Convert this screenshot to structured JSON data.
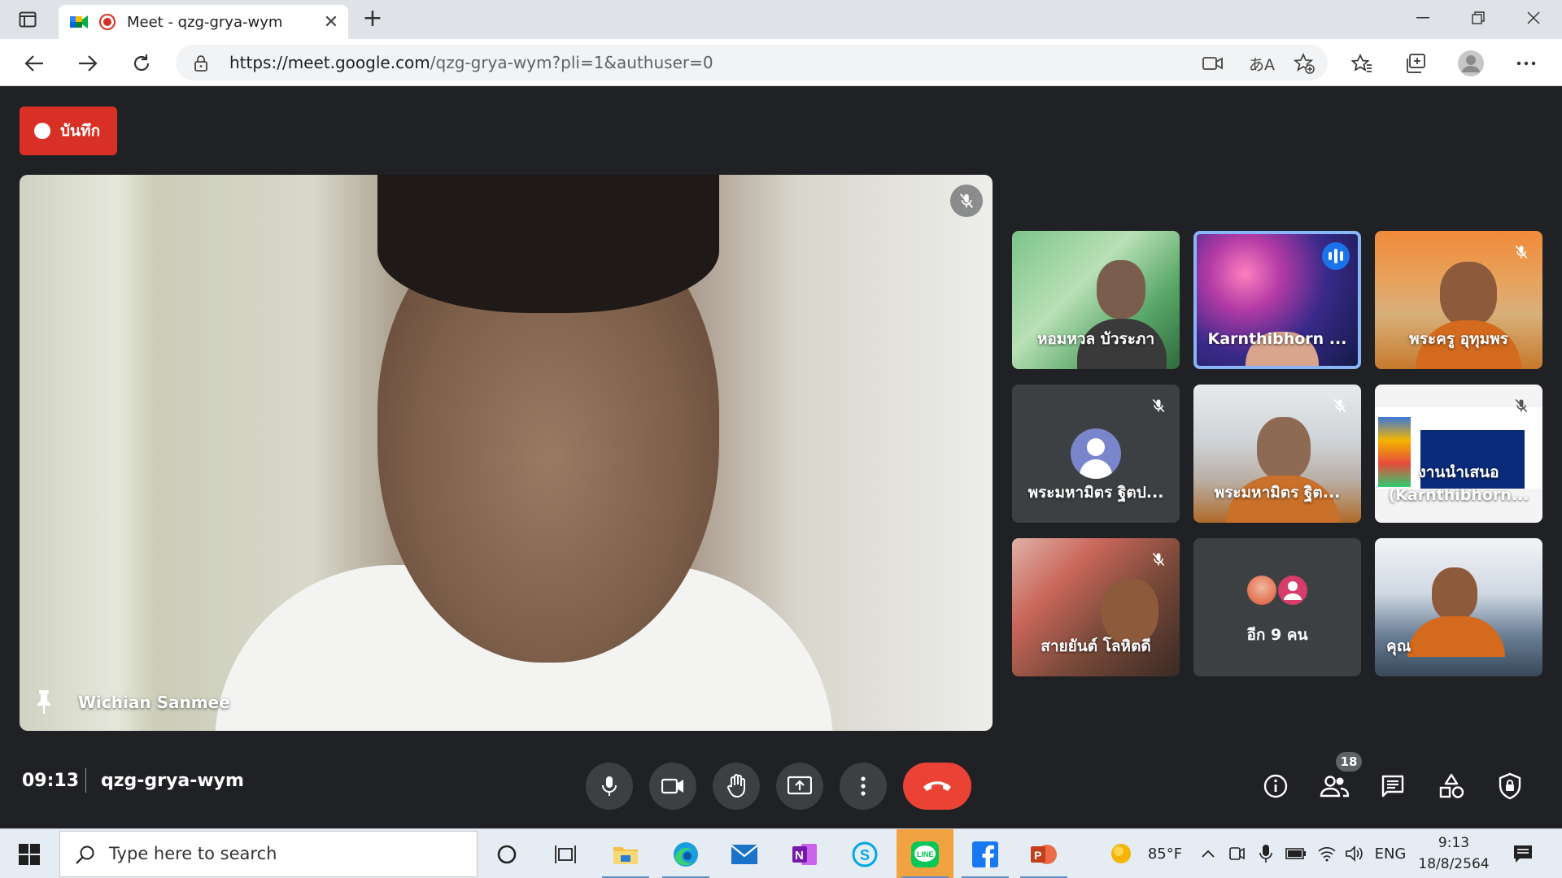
{
  "browser": {
    "tab_title": "Meet - qzg-grya-wym",
    "tab_close": "✕",
    "new_tab": "+",
    "url_host": "https://meet.google.com",
    "url_path": "/qzg-grya-wym?pli=1&authuser=0",
    "translate_label": "あA"
  },
  "meet": {
    "recording_label": "บันทึก",
    "main_speaker": "Wichian Sanmee",
    "tiles": [
      {
        "name": "หอมหวล บัวระภา",
        "muted": false
      },
      {
        "name": "Karnthibhorn ...",
        "speaking": true
      },
      {
        "name": "พระครู อุทุมพร",
        "muted": true
      },
      {
        "name": "พระมหามิตร ฐิตป...",
        "muted": true
      },
      {
        "name": "พระมหามิตร ฐิต...",
        "muted": true
      },
      {
        "name": "งานนำเสนอ (Karnthibhorn...",
        "muted": true
      },
      {
        "name": "สายยันต์ โลหิตดี",
        "muted": true
      },
      {
        "name": "อีก 9 คน"
      },
      {
        "name": "คุณ"
      }
    ],
    "time": "09:13",
    "meeting_code": "qzg-grya-wym",
    "participant_count": "18"
  },
  "taskbar": {
    "search_placeholder": "Type here to search",
    "weather_temp": "85°F",
    "language": "ENG",
    "clock_time": "9:13",
    "clock_date": "18/8/2564"
  },
  "colors": {
    "meet_bg": "#202124",
    "record_red": "#d93025",
    "end_call_red": "#ea4335",
    "speaking_blue": "#8ab4f8",
    "talk_badge_blue": "#1a73e8"
  }
}
